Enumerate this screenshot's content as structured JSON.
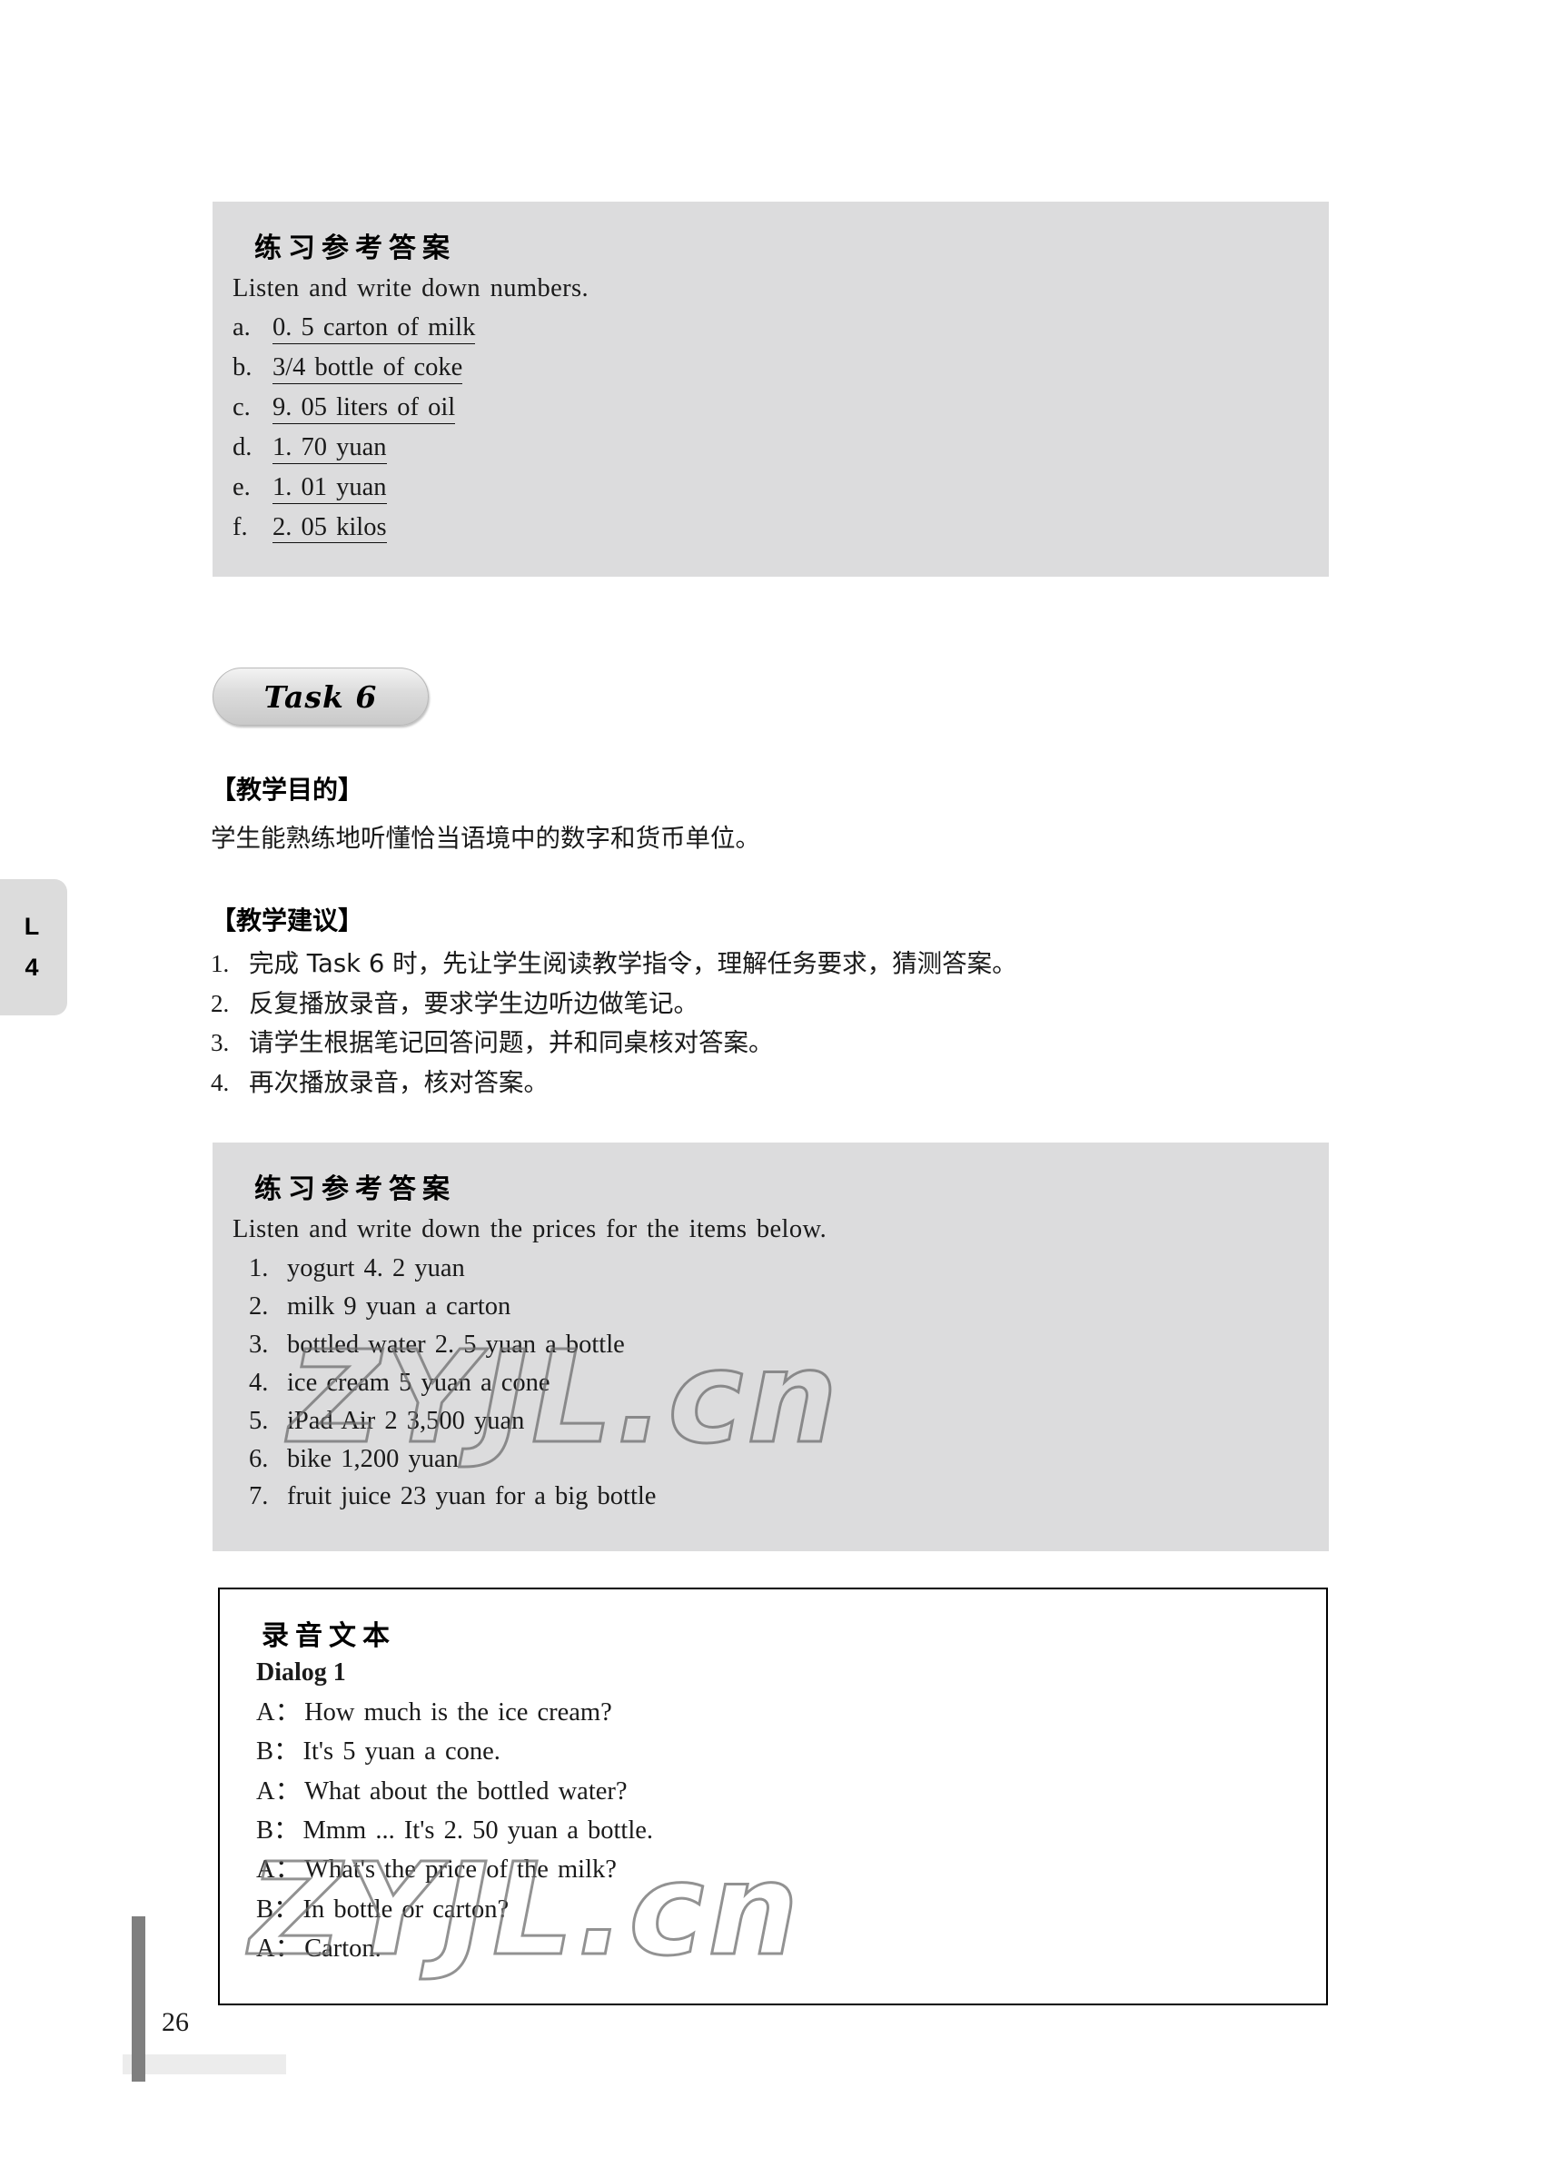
{
  "page": {
    "number": "26",
    "side_tab": {
      "line1": "L",
      "line2": "4"
    },
    "watermark_text": "ZYJL.cn"
  },
  "answer_box_1": {
    "heading": "练习参考答案",
    "intro": "Listen and write down numbers.",
    "items": [
      {
        "marker": "a.",
        "value": "0. 5 carton of milk"
      },
      {
        "marker": "b.",
        "value": "3/4 bottle of coke"
      },
      {
        "marker": "c.",
        "value": "9. 05 liters of oil"
      },
      {
        "marker": "d.",
        "value": "1. 70 yuan"
      },
      {
        "marker": "e.",
        "value": "1. 01 yuan"
      },
      {
        "marker": "f.",
        "value": "2. 05 kilos"
      }
    ]
  },
  "task_pill": {
    "label": "Task 6"
  },
  "teaching_aim": {
    "heading": "【教学目的】",
    "text": "学生能熟练地听懂恰当语境中的数字和货币单位。"
  },
  "teaching_tips": {
    "heading": "【教学建议】",
    "items": [
      {
        "num": "1.",
        "text": "完成 Task 6 时，先让学生阅读教学指令，理解任务要求，猜测答案。"
      },
      {
        "num": "2.",
        "text": "反复播放录音，要求学生边听边做笔记。"
      },
      {
        "num": "3.",
        "text": "请学生根据笔记回答问题，并和同桌核对答案。"
      },
      {
        "num": "4.",
        "text": "再次播放录音，核对答案。"
      }
    ]
  },
  "answer_box_2": {
    "heading": "练习参考答案",
    "intro": "Listen and write down the prices for the items below.",
    "items": [
      {
        "marker": "1.",
        "value": "yogurt 4. 2 yuan"
      },
      {
        "marker": "2.",
        "value": "milk 9 yuan a carton"
      },
      {
        "marker": "3.",
        "value": "bottled water 2. 5 yuan a bottle"
      },
      {
        "marker": "4.",
        "value": "ice cream 5 yuan a cone"
      },
      {
        "marker": "5.",
        "value": "iPad Air 2 3,500 yuan"
      },
      {
        "marker": "6.",
        "value": "bike 1,200 yuan"
      },
      {
        "marker": "7.",
        "value": "fruit juice 23 yuan for a big bottle"
      }
    ]
  },
  "transcript": {
    "heading": "录音文本",
    "dialog_title": "Dialog 1",
    "lines": [
      {
        "speaker": "A：",
        "text": "How much is the ice cream?"
      },
      {
        "speaker": "B：",
        "text": "It's 5 yuan a cone."
      },
      {
        "speaker": "A：",
        "text": "What about the bottled water?"
      },
      {
        "speaker": "B：",
        "text": "Mmm ... It's 2. 50 yuan a bottle."
      },
      {
        "speaker": "A：",
        "text": "What's the price of the milk?"
      },
      {
        "speaker": "B：",
        "text": "In bottle or carton?"
      },
      {
        "speaker": "A：",
        "text": "Carton."
      }
    ]
  }
}
